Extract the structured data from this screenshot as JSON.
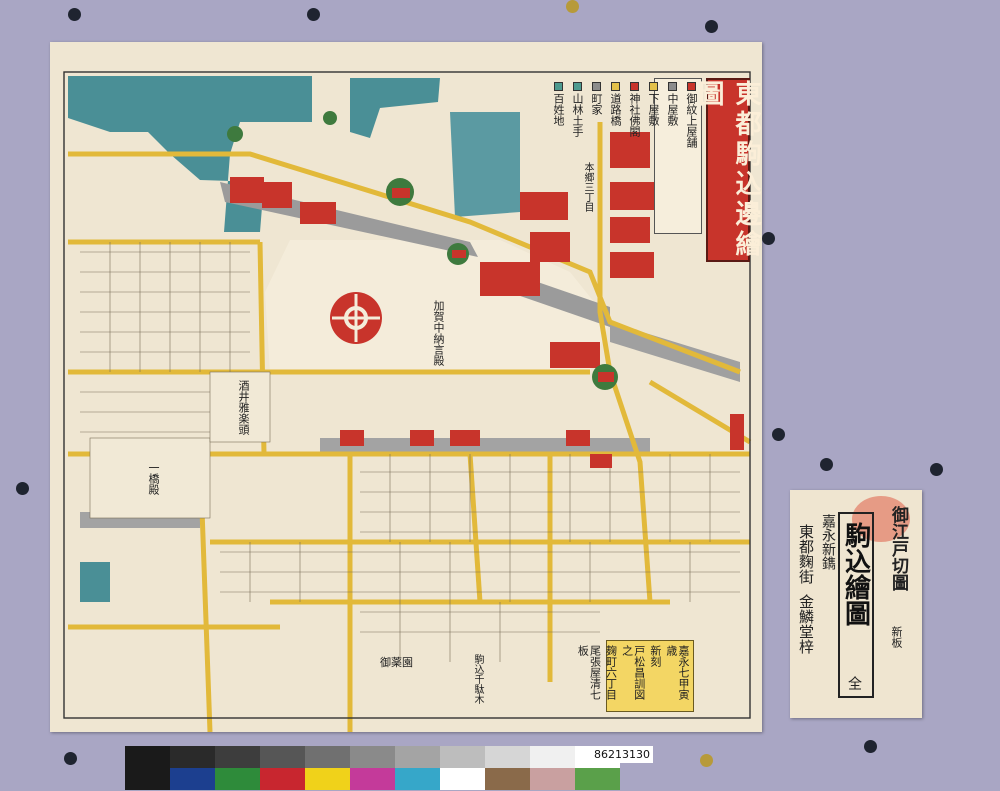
{
  "map": {
    "title": "東都駒込邊繪圖",
    "legend": [
      {
        "label": "御紋上屋舗",
        "color": "#c8342b"
      },
      {
        "label": "中屋敷",
        "color": "#8c8c8c"
      },
      {
        "label": "下屋敷",
        "color": "#e2c04a"
      },
      {
        "label": "神社佛閣",
        "color": "#c8342b"
      },
      {
        "label": "道路橋",
        "color": "#e2c04a"
      },
      {
        "label": "町家",
        "color": "#8c8c8c"
      },
      {
        "label": "山林土手",
        "color": "#4d9a8f"
      },
      {
        "label": "百姓地",
        "color": "#4d9a8f"
      }
    ],
    "estates": [
      {
        "label": "加賀中納言殿"
      },
      {
        "label": "本郷三丁目"
      },
      {
        "label": "酒井雅楽頭"
      },
      {
        "label": "一橋殿"
      },
      {
        "label": "御薬園"
      },
      {
        "label": "駒込千駄木"
      }
    ],
    "publisher": {
      "lines": [
        "嘉永七甲寅歳",
        "新刻",
        "戸松昌訓図之",
        "麹町六丁目",
        "尾張屋清七板"
      ]
    }
  },
  "cover": {
    "series_label": "御江戸切圖",
    "edition_label": "新板",
    "side_label": "嘉永新鐫",
    "title": "駒込繪圖",
    "city_label": "東都麴街",
    "publisher": "金鱗堂梓",
    "price_mark": "全"
  },
  "accession_number": "86213130",
  "colorbar": {
    "top_row": [
      "#1a1a1a",
      "#2a2a2a",
      "#3d3d3d",
      "#565656",
      "#707070",
      "#8a8a8a",
      "#a4a4a4",
      "#bdbdbd",
      "#d6d6d6",
      "#f0f0f0",
      "#ffffff"
    ],
    "bottom_row": [
      "#1a1a1a",
      "#1c3f8f",
      "#2e8b3a",
      "#c8262f",
      "#f0d21a",
      "#c43a9a",
      "#36a7c9",
      "#ffffff",
      "#8a6a4a",
      "#c9a0a0",
      "#5aa04a"
    ]
  }
}
